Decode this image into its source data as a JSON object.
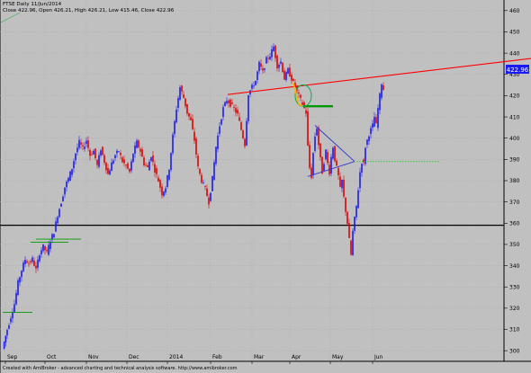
{
  "header": {
    "title_line": "FTSE  Daily  11/Jun/2014",
    "ohlc_line": "Close 422.96, Open 426.21, High 426.21, Low 415.46, Close 422.96"
  },
  "footer": {
    "credit": "Created with AmiBroker - advanced charting and technical analysis software. http://www.amibroker.com"
  },
  "price_badge": "422.96",
  "colors": {
    "background": "#c0c0c0",
    "up": "#1a1aff",
    "down": "#e00000",
    "trend_line": "#ff0000",
    "support_line": "#000000",
    "triangle": "#3333cc",
    "dotted_level": "#00cc00",
    "short_level": "#009900",
    "circle": "#00b050",
    "wedge": "#ffb000",
    "badge_bg": "#1a1aff"
  },
  "chart_data": {
    "type": "candlestick",
    "ylim": [
      295,
      465
    ],
    "y_ticks": [
      300,
      310,
      320,
      330,
      340,
      350,
      360,
      370,
      380,
      390,
      400,
      410,
      420,
      430,
      440,
      450,
      460
    ],
    "x_ticks": [
      {
        "label": "Sep",
        "x": 6
      },
      {
        "label": "Oct",
        "x": 50
      },
      {
        "label": "Nov",
        "x": 96
      },
      {
        "label": "Dec",
        "x": 141
      },
      {
        "label": "2014",
        "x": 186
      },
      {
        "label": "Feb",
        "x": 234
      },
      {
        "label": "Mar",
        "x": 280
      },
      {
        "label": "Apr",
        "x": 322
      },
      {
        "label": "May",
        "x": 367
      },
      {
        "label": "Jun",
        "x": 414
      }
    ],
    "close_path": [
      [
        3,
        301
      ],
      [
        8,
        310
      ],
      [
        12,
        316
      ],
      [
        16,
        322
      ],
      [
        20,
        332
      ],
      [
        24,
        338
      ],
      [
        28,
        343
      ],
      [
        32,
        341
      ],
      [
        36,
        343
      ],
      [
        40,
        338
      ],
      [
        44,
        346
      ],
      [
        48,
        349
      ],
      [
        52,
        346
      ],
      [
        56,
        352
      ],
      [
        60,
        356
      ],
      [
        64,
        364
      ],
      [
        68,
        370
      ],
      [
        72,
        377
      ],
      [
        76,
        381
      ],
      [
        80,
        386
      ],
      [
        84,
        393
      ],
      [
        88,
        398
      ],
      [
        92,
        395
      ],
      [
        96,
        399
      ],
      [
        100,
        392
      ],
      [
        104,
        394
      ],
      [
        108,
        387
      ],
      [
        112,
        395
      ],
      [
        116,
        389
      ],
      [
        120,
        383
      ],
      [
        124,
        388
      ],
      [
        128,
        392
      ],
      [
        132,
        394
      ],
      [
        136,
        389
      ],
      [
        140,
        387
      ],
      [
        144,
        384
      ],
      [
        148,
        393
      ],
      [
        152,
        398
      ],
      [
        156,
        394
      ],
      [
        160,
        388
      ],
      [
        164,
        386
      ],
      [
        168,
        392
      ],
      [
        172,
        385
      ],
      [
        176,
        380
      ],
      [
        180,
        374
      ],
      [
        184,
        377
      ],
      [
        188,
        386
      ],
      [
        192,
        401
      ],
      [
        196,
        414
      ],
      [
        200,
        424
      ],
      [
        204,
        419
      ],
      [
        208,
        412
      ],
      [
        212,
        408
      ],
      [
        216,
        399
      ],
      [
        220,
        386
      ],
      [
        224,
        380
      ],
      [
        228,
        376
      ],
      [
        232,
        370
      ],
      [
        236,
        381
      ],
      [
        240,
        396
      ],
      [
        244,
        406
      ],
      [
        248,
        414
      ],
      [
        252,
        418
      ],
      [
        256,
        416
      ],
      [
        260,
        414
      ],
      [
        264,
        411
      ],
      [
        268,
        404
      ],
      [
        272,
        397
      ],
      [
        276,
        421
      ],
      [
        280,
        424
      ],
      [
        284,
        427
      ],
      [
        288,
        435
      ],
      [
        292,
        431
      ],
      [
        296,
        437
      ],
      [
        300,
        439
      ],
      [
        304,
        443
      ],
      [
        308,
        434
      ],
      [
        312,
        436
      ],
      [
        316,
        428
      ],
      [
        320,
        432
      ],
      [
        324,
        428
      ],
      [
        328,
        424
      ],
      [
        332,
        420
      ],
      [
        336,
        416
      ],
      [
        340,
        412
      ],
      [
        342,
        396
      ],
      [
        344,
        386
      ],
      [
        346,
        382
      ],
      [
        348,
        393
      ],
      [
        350,
        401
      ],
      [
        352,
        405
      ],
      [
        354,
        397
      ],
      [
        356,
        390
      ],
      [
        358,
        384
      ],
      [
        360,
        389
      ],
      [
        362,
        394
      ],
      [
        364,
        388
      ],
      [
        366,
        384
      ],
      [
        368,
        391
      ],
      [
        370,
        396
      ],
      [
        372,
        390
      ],
      [
        374,
        386
      ],
      [
        376,
        382
      ],
      [
        378,
        376
      ],
      [
        380,
        380
      ],
      [
        382,
        372
      ],
      [
        384,
        366
      ],
      [
        386,
        360
      ],
      [
        388,
        352
      ],
      [
        390,
        345
      ],
      [
        392,
        356
      ],
      [
        394,
        362
      ],
      [
        396,
        368
      ],
      [
        398,
        376
      ],
      [
        400,
        384
      ],
      [
        402,
        389
      ],
      [
        404,
        388
      ],
      [
        406,
        396
      ],
      [
        408,
        399
      ],
      [
        410,
        402
      ],
      [
        412,
        404
      ],
      [
        414,
        406
      ],
      [
        416,
        410
      ],
      [
        418,
        406
      ],
      [
        420,
        414
      ],
      [
        422,
        420
      ],
      [
        424,
        426
      ],
      [
        426,
        423
      ]
    ],
    "annotations": {
      "trend_line": {
        "x1": 253,
        "y1": 420.5,
        "x2": 590,
        "y2": 437.5
      },
      "support_line": {
        "y": 359
      },
      "triangle_upper": {
        "x1": 350,
        "y1": 406,
        "x2": 394,
        "y2": 389
      },
      "triangle_lower": {
        "x1": 342,
        "y1": 382,
        "x2": 394,
        "y2": 389
      },
      "dotted_level": {
        "x1": 396,
        "y": 389,
        "x2": 488
      },
      "short_level": {
        "x1": 338,
        "y": 415,
        "x2": 370
      },
      "small_levels": [
        {
          "x1": 3,
          "x2": 36,
          "y": 318
        },
        {
          "x1": 34,
          "x2": 76,
          "y": 351
        },
        {
          "x1": 40,
          "x2": 90,
          "y": 352.5
        }
      ],
      "circle": {
        "cx": 337,
        "cy": 420,
        "rx": 9,
        "ry": 12
      },
      "wedge": [
        [
          326,
          426
        ],
        [
          332,
          416
        ],
        [
          336,
          415
        ]
      ]
    }
  }
}
